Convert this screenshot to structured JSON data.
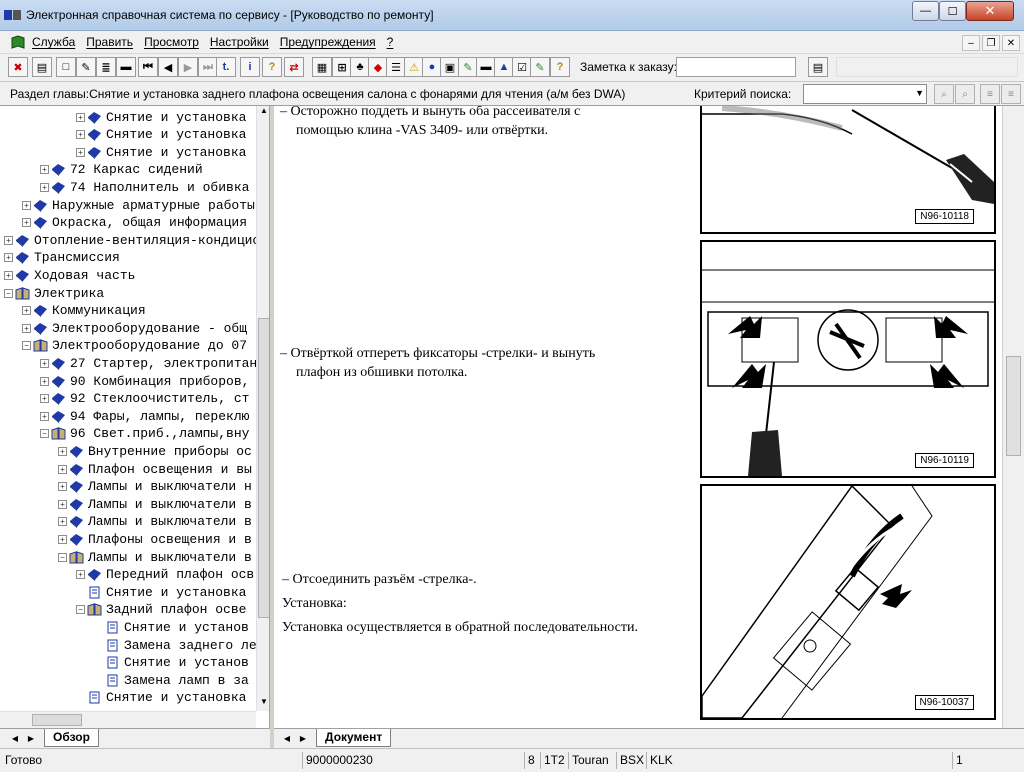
{
  "window": {
    "title": "Электронная справочная система по сервису - [Руководство по ремонту]",
    "minimize": "—",
    "maximize": "☐",
    "close": "✕"
  },
  "menu": {
    "items": [
      "Служба",
      "Править",
      "Просмотр",
      "Настройки",
      "Предупреждения",
      "?"
    ],
    "mdi_minimize": "–",
    "mdi_restore": "❐",
    "mdi_close": "✕"
  },
  "toolbar": {
    "order_note_label": "Заметка к заказу:",
    "order_note_value": ""
  },
  "section_bar": {
    "section_label": "Раздел главы:Снятие и установка заднего плафона освещения салона с фонарями для чтения (а/м без DWA)",
    "search_label": "Критерий поиска:",
    "search_value": ""
  },
  "tree": {
    "items": [
      {
        "text": "Снятие и установка",
        "level": 4,
        "expander": "+",
        "icon": "book-closed-icon"
      },
      {
        "text": "Снятие и установка",
        "level": 4,
        "expander": "+",
        "icon": "book-closed-icon"
      },
      {
        "text": "Снятие и установка",
        "level": 4,
        "expander": "+",
        "icon": "book-closed-icon"
      },
      {
        "text": "72 Каркас сидений",
        "level": 2,
        "expander": "+",
        "icon": "book-closed-icon"
      },
      {
        "text": "74 Наполнитель и обивка",
        "level": 2,
        "expander": "+",
        "icon": "book-closed-icon"
      },
      {
        "text": "Наружные арматурные работы",
        "level": 1,
        "expander": "+",
        "icon": "book-closed-icon"
      },
      {
        "text": "Окраска, общая информация",
        "level": 1,
        "expander": "+",
        "icon": "book-closed-icon"
      },
      {
        "text": "Отопление-вентиляция-кондиционер",
        "level": 0,
        "expander": "+",
        "icon": "book-closed-icon"
      },
      {
        "text": "Трансмиссия",
        "level": 0,
        "expander": "+",
        "icon": "book-closed-icon"
      },
      {
        "text": "Ходовая часть",
        "level": 0,
        "expander": "+",
        "icon": "book-closed-icon"
      },
      {
        "text": "Электрика",
        "level": 0,
        "expander": "−",
        "icon": "book-open-icon"
      },
      {
        "text": "Коммуникация",
        "level": 1,
        "expander": "+",
        "icon": "book-closed-icon"
      },
      {
        "text": "Электрооборудование - общ",
        "level": 1,
        "expander": "+",
        "icon": "book-closed-icon"
      },
      {
        "text": "Электрооборудование до 07",
        "level": 1,
        "expander": "−",
        "icon": "book-open-icon"
      },
      {
        "text": "27 Стартер, электропитание",
        "level": 2,
        "expander": "+",
        "icon": "book-closed-icon"
      },
      {
        "text": "90 Комбинация приборов,",
        "level": 2,
        "expander": "+",
        "icon": "book-closed-icon"
      },
      {
        "text": "92 Стеклоочиститель, ст",
        "level": 2,
        "expander": "+",
        "icon": "book-closed-icon"
      },
      {
        "text": "94 Фары, лампы, переклю",
        "level": 2,
        "expander": "+",
        "icon": "book-closed-icon"
      },
      {
        "text": "96 Свет.приб.,лампы,вну",
        "level": 2,
        "expander": "−",
        "icon": "book-open-icon"
      },
      {
        "text": "Внутренние приборы ос",
        "level": 3,
        "expander": "+",
        "icon": "book-closed-icon"
      },
      {
        "text": "Плафон освещения и вы",
        "level": 3,
        "expander": "+",
        "icon": "book-closed-icon"
      },
      {
        "text": "Лампы и выключатели н",
        "level": 3,
        "expander": "+",
        "icon": "book-closed-icon"
      },
      {
        "text": "Лампы и выключатели в",
        "level": 3,
        "expander": "+",
        "icon": "book-closed-icon"
      },
      {
        "text": "Лампы и выключатели в",
        "level": 3,
        "expander": "+",
        "icon": "book-closed-icon"
      },
      {
        "text": "Плафоны освещения и в",
        "level": 3,
        "expander": "+",
        "icon": "book-closed-icon"
      },
      {
        "text": "Лампы и выключатели в",
        "level": 3,
        "expander": "−",
        "icon": "book-open-icon"
      },
      {
        "text": "Передний плафон осв",
        "level": 4,
        "expander": "+",
        "icon": "book-closed-icon"
      },
      {
        "text": "Снятие и установка",
        "level": 4,
        "expander": "",
        "icon": "page-icon"
      },
      {
        "text": "Задний плафон осве",
        "level": 4,
        "expander": "−",
        "icon": "book-open-icon"
      },
      {
        "text": "Снятие и установ",
        "level": 5,
        "expander": "",
        "icon": "page-icon"
      },
      {
        "text": "Замена заднего ле",
        "level": 5,
        "expander": "",
        "icon": "page-icon"
      },
      {
        "text": "Снятие и установ",
        "level": 5,
        "expander": "",
        "icon": "page-icon"
      },
      {
        "text": "Замена ламп в за",
        "level": 5,
        "expander": "",
        "icon": "page-icon"
      },
      {
        "text": "Снятие и установка",
        "level": 4,
        "expander": "",
        "icon": "page-icon"
      }
    ]
  },
  "left_tabs": {
    "active": "Обзор"
  },
  "right_tabs": {
    "active": "Документ"
  },
  "document": {
    "steps": [
      {
        "bullet": "–",
        "text": "Осторожно поддеть и вынуть оба рассеивателя с",
        "cont": "помощью клина -VAS 3409- или отвёртки."
      },
      {
        "bullet": "–",
        "text": "Отвёрткой отперетъ фиксаторы -стрелки- и вынуть",
        "cont": "плафон из обшивки потолка."
      },
      {
        "bullet": "–",
        "text": "Отсоединить разъём -стрелка-.",
        "cont": ""
      }
    ],
    "install_heading": "Установка:",
    "install_text": "Установка осуществляется в обратной последовательности.",
    "figures": [
      "N96-10118",
      "N96-10119",
      "N96-10037"
    ]
  },
  "status": {
    "ready": "Готово",
    "order_number": "9000000230",
    "cell1": "8",
    "cell2": "1T2",
    "model": "Touran",
    "engine": "BSX",
    "gearbox": "KLK",
    "page": "1"
  },
  "colors": {
    "titlebar": "#b9d1ec",
    "book_icon": "#1f3aa8"
  }
}
